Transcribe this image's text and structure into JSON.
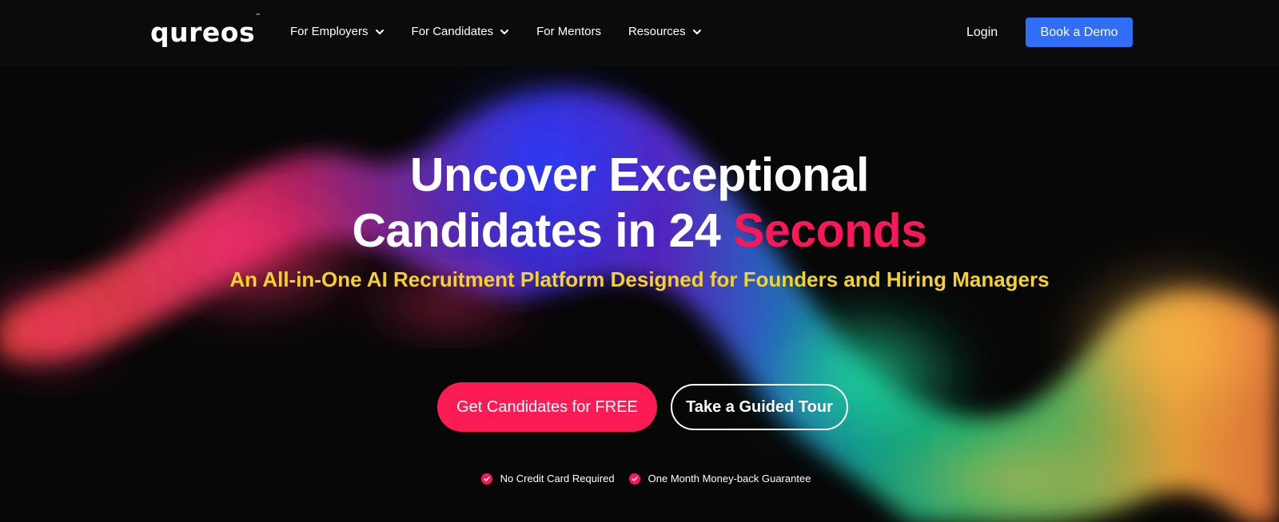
{
  "brand": {
    "logo_text": "qureos",
    "logo_mark": "™"
  },
  "nav": {
    "items": [
      {
        "label": "For Employers",
        "has_dropdown": true
      },
      {
        "label": "For Candidates",
        "has_dropdown": true
      },
      {
        "label": "For Mentors",
        "has_dropdown": false
      },
      {
        "label": "Resources",
        "has_dropdown": true
      }
    ],
    "login_label": "Login",
    "demo_label": "Book a Demo"
  },
  "hero": {
    "headline_line1": "Uncover Exceptional",
    "headline_line2_prefix": "Candidates in 24",
    "headline_line2_accent": "Seconds",
    "subheadline": "An All-in-One AI Recruitment Platform Designed for Founders and Hiring Managers",
    "cta_primary": "Get Candidates for FREE",
    "cta_secondary": "Take a Guided Tour",
    "benefits": [
      {
        "label": "No Credit Card Required",
        "icon": "check-circle-icon"
      },
      {
        "label": "One Month Money-back Guarantee",
        "icon": "check-circle-icon"
      }
    ]
  },
  "colors": {
    "background": "#070707",
    "accent_pink": "#fb1758",
    "accent_yellow": "#f2d22b",
    "demo_blue": "#2f6ef5"
  }
}
